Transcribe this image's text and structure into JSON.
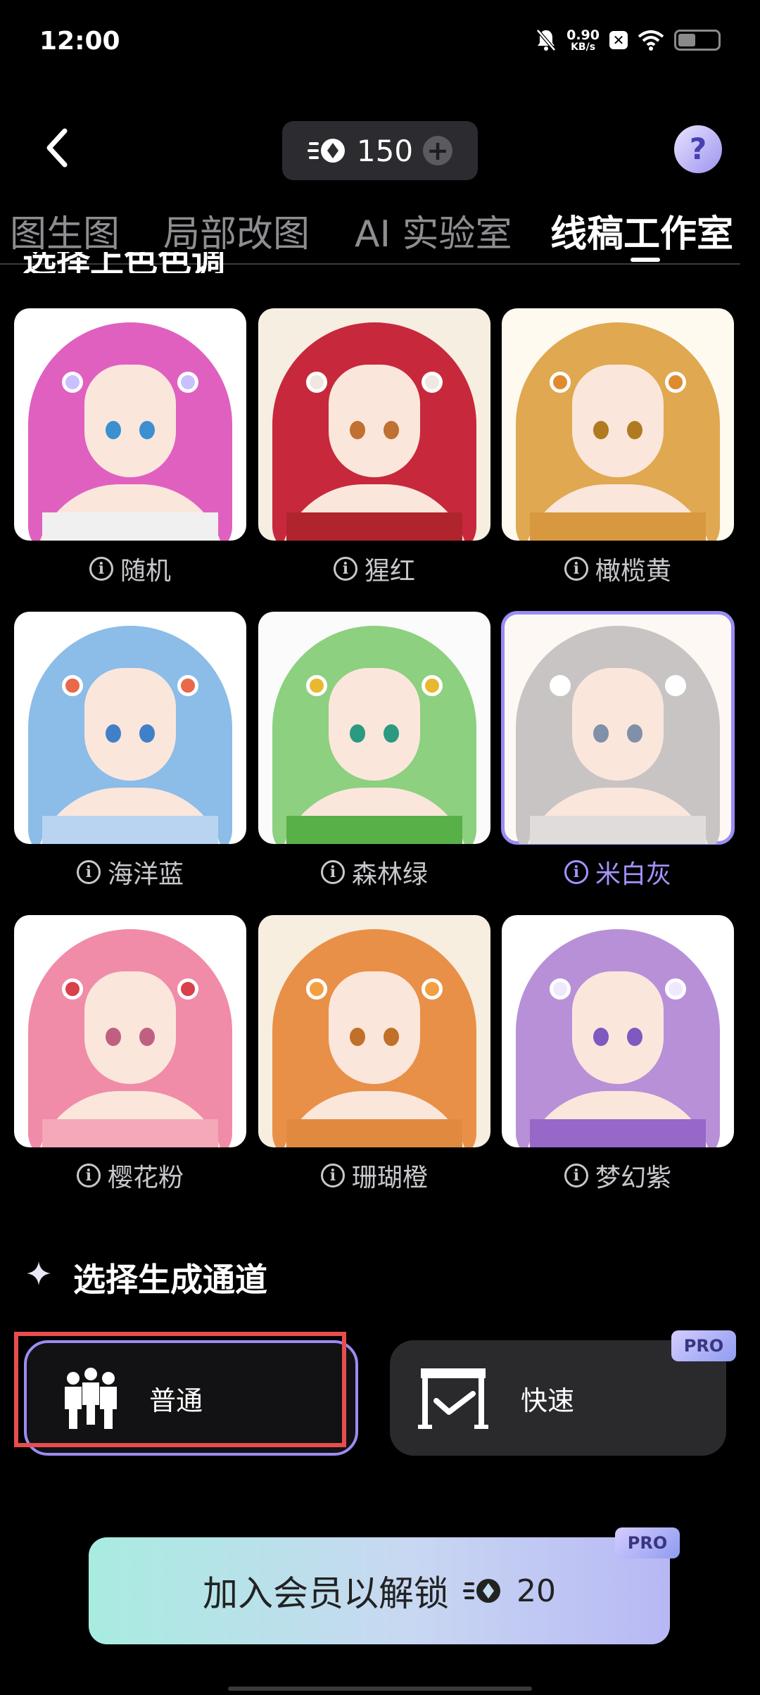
{
  "status_bar": {
    "time": "12:00",
    "speed_value": "0.90",
    "speed_unit": "KB/s"
  },
  "header": {
    "credits": "150"
  },
  "tabs": [
    {
      "label": "图生图",
      "active": false
    },
    {
      "label": "局部改图",
      "active": false
    },
    {
      "label": "AI 实验室",
      "active": false
    },
    {
      "label": "线稿工作室",
      "active": true
    }
  ],
  "palette_section": {
    "title_partial": "选择上色色调"
  },
  "palettes": [
    {
      "label": "随机",
      "hair": "#e060c0",
      "eye": "#3a90d0",
      "dress": "#f0f0f0",
      "flower": "#c8c0ff",
      "bg": "#ffffff"
    },
    {
      "label": "猩红",
      "hair": "#c8283c",
      "eye": "#c07030",
      "dress": "#b0242e",
      "flower": "#f0e8e0",
      "bg": "#f7eee2"
    },
    {
      "label": "橄榄黄",
      "hair": "#e0a850",
      "eye": "#b07a20",
      "dress": "#d89840",
      "flower": "#e08a30",
      "bg": "#fffaf0"
    },
    {
      "label": "海洋蓝",
      "hair": "#8cbce8",
      "eye": "#4080c8",
      "dress": "#b8d4f0",
      "flower": "#e86a4a",
      "bg": "#ffffff"
    },
    {
      "label": "森林绿",
      "hair": "#8cd080",
      "eye": "#2a9a80",
      "dress": "#58b048",
      "flower": "#e8b830",
      "bg": "#fbfbfb"
    },
    {
      "label": "米白灰",
      "hair": "#c8c4c4",
      "eye": "#8090a8",
      "dress": "#e0dcdc",
      "flower": "#ffffff",
      "bg": "#fdf8f4",
      "selected": true
    },
    {
      "label": "樱花粉",
      "hair": "#f08ca8",
      "eye": "#c06080",
      "dress": "#f4a8b8",
      "flower": "#d8404a",
      "bg": "#ffffff"
    },
    {
      "label": "珊瑚橙",
      "hair": "#e89048",
      "eye": "#c07028",
      "dress": "#e08a40",
      "flower": "#f4a040",
      "bg": "#f7eee0"
    },
    {
      "label": "梦幻紫",
      "hair": "#b890d8",
      "eye": "#8058c0",
      "dress": "#9868c8",
      "flower": "#f0e8ff",
      "bg": "#ffffff"
    }
  ],
  "channel_section": {
    "title": "选择生成通道"
  },
  "channels": {
    "normal": "普通",
    "fast": "快速",
    "pro_badge": "PRO"
  },
  "join": {
    "label": "加入会员以解锁",
    "cost": "20",
    "pro_badge": "PRO"
  },
  "colors": {
    "accent": "#9b8cf5",
    "highlight": "#e84d4d"
  }
}
